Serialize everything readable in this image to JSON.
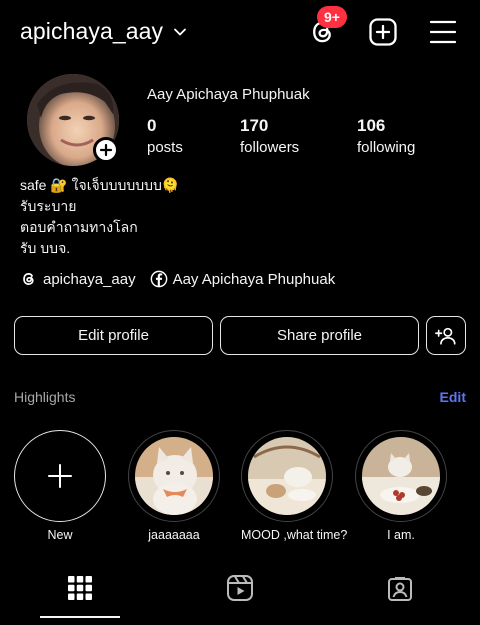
{
  "header": {
    "username": "apichaya_aay",
    "notification_badge": "9+"
  },
  "profile": {
    "full_name": "Aay Apichaya Phuphuak",
    "stats": [
      {
        "value": "0",
        "label": "posts"
      },
      {
        "value": "170",
        "label": "followers"
      },
      {
        "value": "106",
        "label": "following"
      }
    ],
    "bio": [
      "safe 🔐 ใจเจ็บบบบบบบ🫠",
      "รับระบาย",
      "ตอบคำถามทางโลก",
      "รับ บบจ."
    ],
    "links": {
      "threads": "apichaya_aay",
      "facebook": "Aay Apichaya Phuphuak"
    }
  },
  "buttons": {
    "edit_profile": "Edit profile",
    "share_profile": "Share profile"
  },
  "highlights": {
    "title": "Highlights",
    "edit": "Edit",
    "items": [
      {
        "label": "New"
      },
      {
        "label": "jaaaaaaa"
      },
      {
        "label": "MOOD ,what time?"
      },
      {
        "label": "I am."
      }
    ]
  },
  "colors": {
    "background": "#000000",
    "badge": "#ff3040",
    "link_blue": "#5b76f7"
  },
  "icons": [
    "chevron-down-icon",
    "threads-icon",
    "add-square-icon",
    "menu-icon",
    "add-person-icon",
    "grid-icon",
    "reels-icon",
    "tagged-icon",
    "facebook-icon"
  ]
}
